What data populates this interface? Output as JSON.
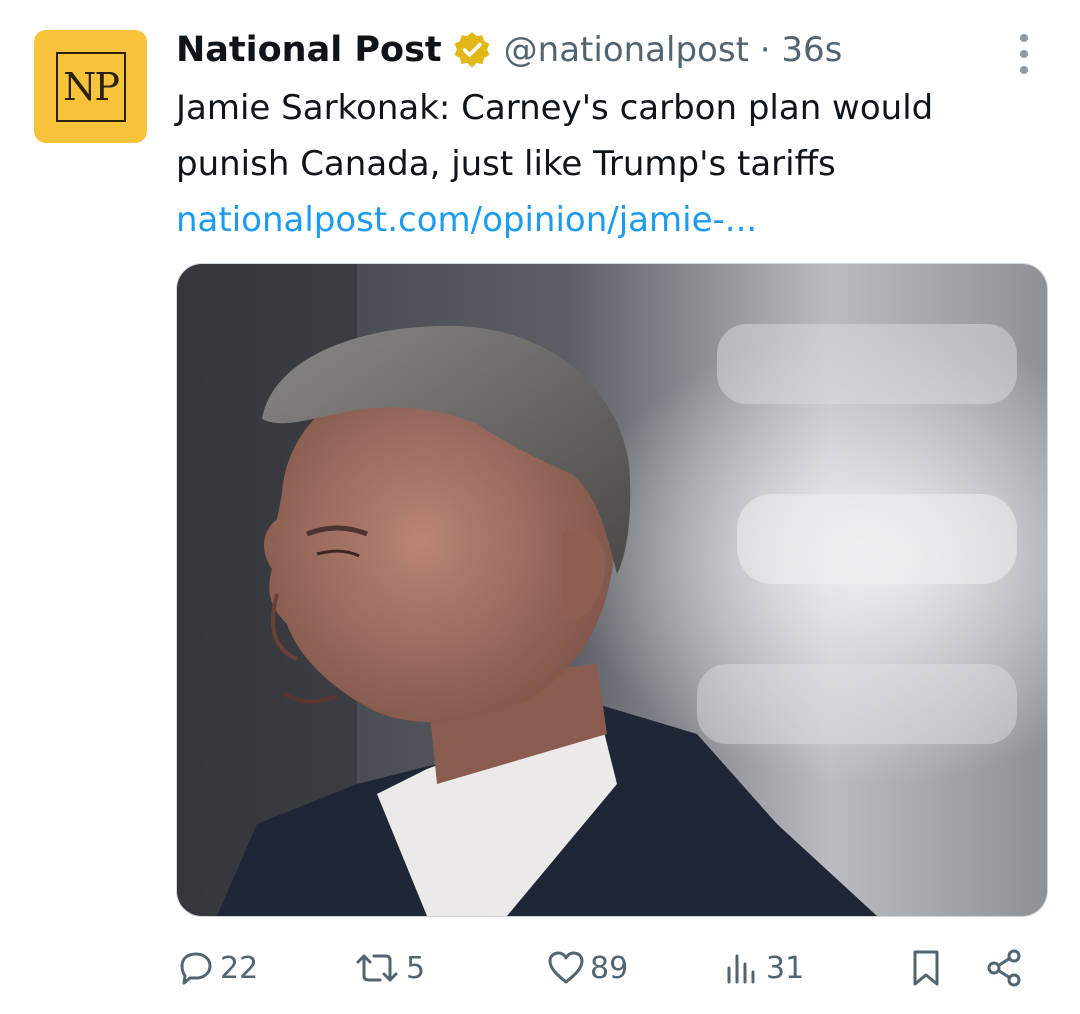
{
  "account": {
    "avatar_text": "NP",
    "name": "National Post",
    "handle_time": "@nationalpost · 36s",
    "verified_badge_icon": "gold-verified-badge-icon",
    "avatar_color": "#f7c33b"
  },
  "tweet": {
    "text_line1": "Jamie Sarkonak: Carney's carbon plan would",
    "text_line2": "punish Canada, just like Trump's tariffs",
    "link": "nationalpost.com/opinion/jamie-...",
    "link_color": "#1d9bf0"
  },
  "actions": {
    "reply_count": "22",
    "retweet_count": "5",
    "like_count": "89",
    "views_count": "31"
  },
  "icons": [
    "more-icon",
    "reply-icon",
    "retweet-icon",
    "like-icon",
    "views-icon",
    "bookmark-icon",
    "share-icon"
  ]
}
